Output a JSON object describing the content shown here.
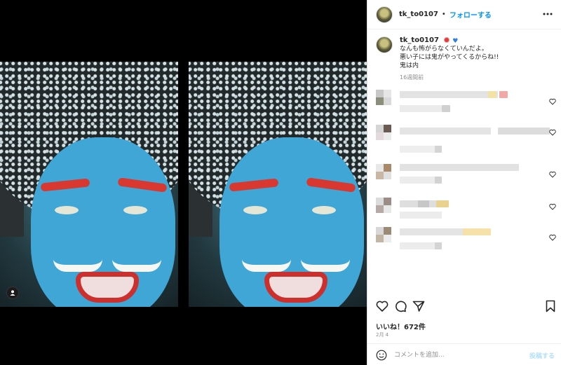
{
  "header": {
    "username": "tk_to0107",
    "separator": "•",
    "follow_label": "フォローする",
    "more_icon": "more-horizontal-icon"
  },
  "caption": {
    "username": "tk_to0107",
    "emoji": [
      "red-circle-emoji",
      "blue-heart-emoji"
    ],
    "lines": [
      "なんも怖がらなくていんだよ。",
      "悪い子には鬼がやってくるからね!!",
      "鬼は内"
    ],
    "time_ago": "16週間前"
  },
  "comments": [
    {
      "type": "blurred-comment",
      "liked": false
    },
    {
      "type": "blurred-comment",
      "liked": false
    },
    {
      "type": "blurred-comment",
      "liked": false
    },
    {
      "type": "blurred-comment",
      "liked": false
    },
    {
      "type": "blurred-comment",
      "liked": false
    }
  ],
  "actions": {
    "like_icon": "heart-icon",
    "comment_icon": "comment-icon",
    "share_icon": "share-icon",
    "save_icon": "bookmark-icon"
  },
  "likes_label": "いいね！672件",
  "date": "2月 4",
  "comment_bar": {
    "placeholder": "コメントを追加...",
    "post_label": "投稿する",
    "emoji_icon": "smiley-icon"
  },
  "media": {
    "user_tag_icon": "user-tag-icon"
  },
  "colors": {
    "accent": "#0095f6",
    "post_disabled": "#b2dffc",
    "muted": "#8e8e8e",
    "media_bg": "#000000"
  }
}
